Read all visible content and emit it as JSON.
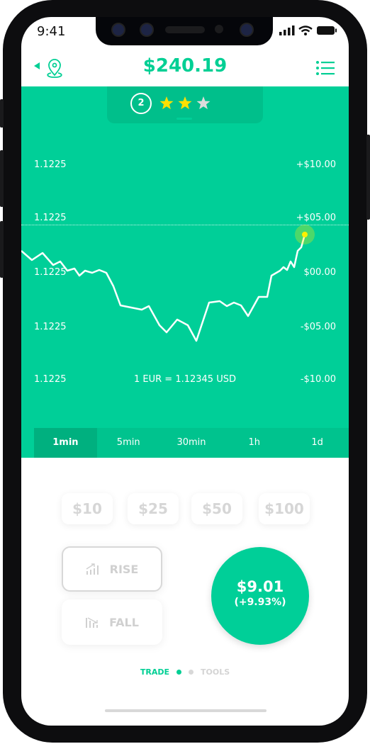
{
  "status": {
    "time": "9:41"
  },
  "header": {
    "balance": "$240.19",
    "back_icon": "triangle-left-icon",
    "location_icon": "map-pin-icon",
    "menu_icon": "list-icon"
  },
  "level": {
    "number": "2",
    "stars_filled": 2,
    "stars_total": 3
  },
  "chart": {
    "left_labels": [
      "1.1225",
      "1.1225",
      "1.1225",
      "1.1225",
      "1.1225"
    ],
    "right_labels": [
      "+$10.00",
      "+$05.00",
      "$00.00",
      "-$05.00",
      "-$10.00"
    ],
    "rate": "1 EUR = 1.12345 USD"
  },
  "timeframes": [
    {
      "label": "1min",
      "active": true
    },
    {
      "label": "5min"
    },
    {
      "label": "30min"
    },
    {
      "label": "1h"
    },
    {
      "label": "1d"
    }
  ],
  "amounts": [
    "$10",
    "$25",
    "$50",
    "$100"
  ],
  "directions": {
    "rise": "RISE",
    "fall": "FALL"
  },
  "profit": {
    "value": "$9.01",
    "percent": "(+9.93%)"
  },
  "pager": {
    "trade": "TRADE",
    "tools": "TOOLS"
  },
  "colors": {
    "accent": "#00cf98",
    "star": "#ffe000"
  }
}
